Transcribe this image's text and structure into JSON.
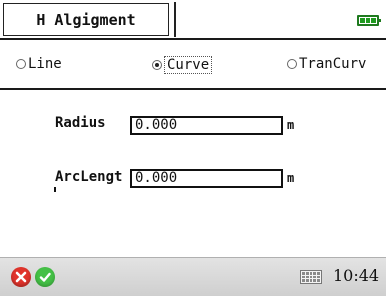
{
  "title": "H Algigment",
  "radios": [
    {
      "label": "Line",
      "checked": false
    },
    {
      "label": "Curve",
      "checked": true
    },
    {
      "label": "TranCurv",
      "checked": false
    }
  ],
  "fields": {
    "radius": {
      "label": "Radius",
      "value": "0.000",
      "unit": "m"
    },
    "arc_length": {
      "label": "ArcLengt",
      "value": "0.000",
      "unit": "m"
    }
  },
  "status": {
    "time": "10:44",
    "battery_color": "#1f9a1f"
  },
  "icons": {
    "cancel": "x-circle-icon",
    "ok": "check-circle-icon",
    "keyboard": "keyboard-icon",
    "battery": "battery-icon"
  }
}
